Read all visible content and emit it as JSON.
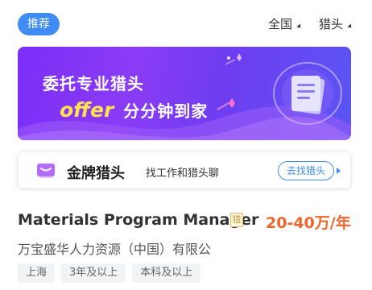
{
  "header": {
    "active_tab": "推荐",
    "filters": [
      {
        "label": "全国",
        "icon": "caret-icon"
      },
      {
        "label": "猎头",
        "icon": "caret-icon"
      }
    ]
  },
  "banner": {
    "line1": "委托专业猎头",
    "offer": "offer",
    "line2": "分分钟到家",
    "colors": {
      "accent": "#ffe34d",
      "bg_start": "#7b2ff7",
      "bg_end": "#5a55f3"
    }
  },
  "gold_card": {
    "title": "金牌猎头",
    "description": "找工作和猎头聊",
    "button": "去找猎头",
    "icon": "chat-message-icon"
  },
  "job": {
    "title": "Materials Program Manager",
    "badge": "猎",
    "salary": "20-40万/年",
    "company": "万宝盛华人力资源（中国）有限公",
    "tags": [
      "上海",
      "3年及以上",
      "本科及以上"
    ],
    "colors": {
      "salary": "#f0642b",
      "badge": "#c8962e"
    }
  },
  "colors": {
    "primary": "#3f8cf4"
  }
}
